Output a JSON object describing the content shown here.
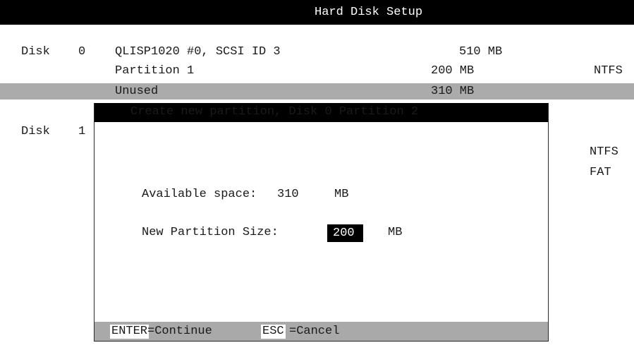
{
  "title": "Hard Disk Setup",
  "disks": [
    {
      "label": "Disk",
      "number": "0",
      "description": "QLISP1020 #0, SCSI ID 3",
      "size": "510 MB",
      "partitions": [
        {
          "name": "Partition 1",
          "size": "200 MB",
          "fs": "NTFS"
        },
        {
          "name": "Unused",
          "size": "310 MB",
          "fs": ""
        }
      ]
    },
    {
      "label": "Disk",
      "number": "1",
      "partition_fs": [
        "NTFS",
        "FAT"
      ]
    }
  ],
  "dialog": {
    "title": "Create new partition, Disk 0 Partition 2",
    "available_label": "Available space:",
    "available_value": "310",
    "available_unit": "MB",
    "size_label": "New Partition Size:",
    "size_value": "200",
    "size_unit": "MB",
    "footer": {
      "enter_key": "ENTER",
      "enter_action": "=Continue",
      "esc_key": "ESC",
      "esc_action": "=Cancel"
    }
  },
  "colors": {
    "title_bar": "#000000",
    "highlight": "#ababab",
    "footer": "#a9a9a9"
  }
}
